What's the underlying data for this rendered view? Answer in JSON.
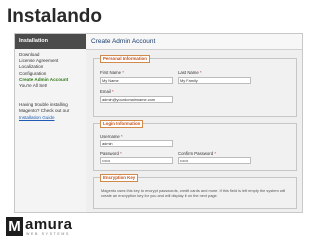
{
  "slide": {
    "title": "Instalando"
  },
  "sidebar": {
    "header": "Installation",
    "items": [
      {
        "label": "Download",
        "active": false
      },
      {
        "label": "License Agreement",
        "active": false
      },
      {
        "label": "Localization",
        "active": false
      },
      {
        "label": "Configuration",
        "active": false
      },
      {
        "label": "Create Admin Account",
        "active": true
      },
      {
        "label": "You're All Set!",
        "active": false
      }
    ],
    "help_lines": [
      "Having trouble installing",
      "Magento? Check out our"
    ],
    "help_link": "Installation Guide"
  },
  "main": {
    "title": "Create Admin Account",
    "personal": {
      "legend": "Personal Information",
      "first_name_label": "First Name",
      "first_name_value": "My Name",
      "last_name_label": "Last Name",
      "last_name_value": "My Family",
      "email_label": "Email",
      "email_value": "admin@yourdomainname.com"
    },
    "login": {
      "legend": "Login Information",
      "username_label": "Username",
      "username_value": "admin",
      "password_label": "Password",
      "password_value": "••••••",
      "confirm_label": "Confirm Password",
      "confirm_value": "••••••"
    },
    "encryption": {
      "legend": "Encryption Key",
      "note": "Magento uses this key to encrypt passwords, credit cards and more. If this field is left empty the system will create an encryption key for you and will display it on the next page."
    },
    "required_mark": "*"
  },
  "logo": {
    "word": "amura",
    "initial": "M",
    "tagline": "WEB SYSTEMS"
  },
  "colors": {
    "accent": "#c4521a",
    "active": "#2f7a17",
    "header": "#4b4b4b"
  }
}
